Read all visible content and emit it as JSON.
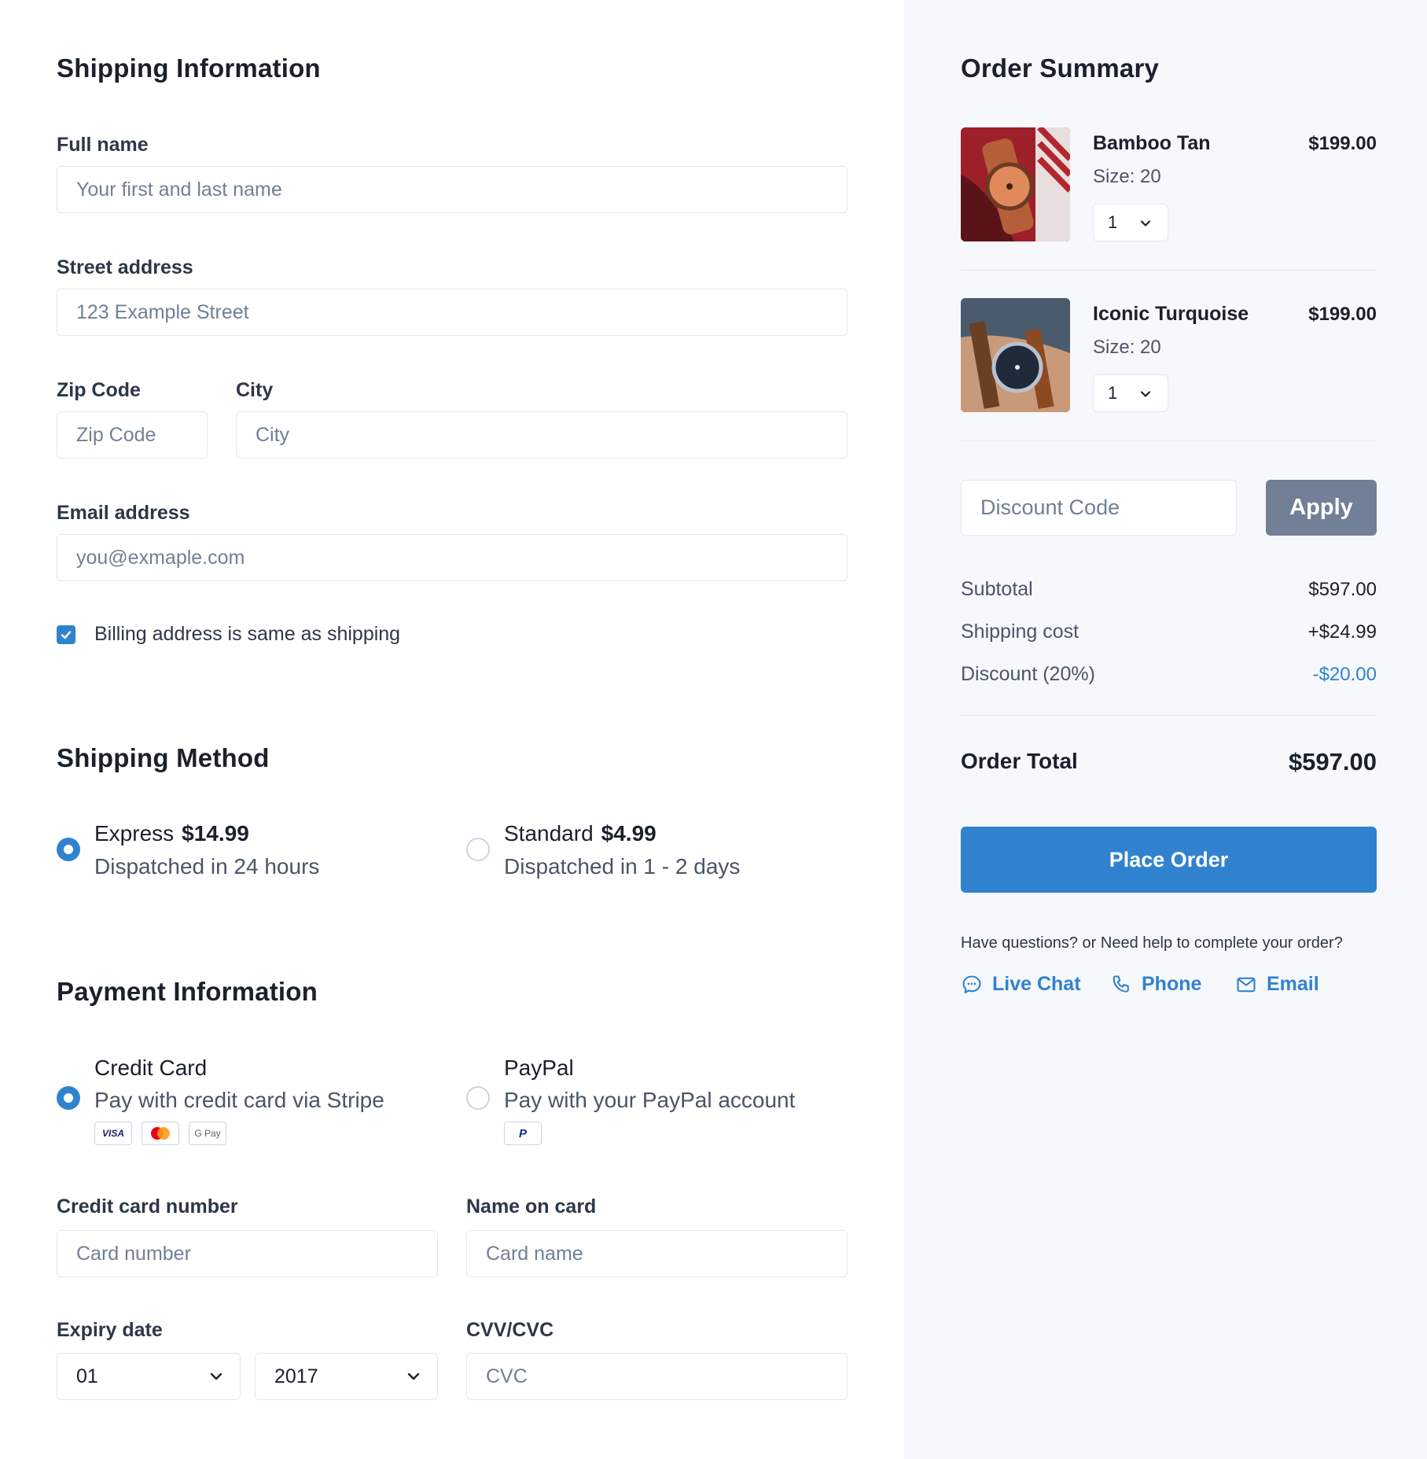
{
  "shipping": {
    "title": "Shipping Information",
    "full_name": {
      "label": "Full name",
      "placeholder": "Your first and last name"
    },
    "street": {
      "label": "Street address",
      "placeholder": "123 Example Street"
    },
    "zip": {
      "label": "Zip Code",
      "placeholder": "Zip Code"
    },
    "city": {
      "label": "City",
      "placeholder": "City"
    },
    "email": {
      "label": "Email address",
      "placeholder": "you@exmaple.com"
    },
    "billing_same": {
      "label": "Billing address is same as shipping",
      "checked": true
    }
  },
  "shipping_method": {
    "title": "Shipping Method",
    "options": [
      {
        "name": "Express",
        "price": "$14.99",
        "desc": "Dispatched in 24 hours",
        "selected": true
      },
      {
        "name": "Standard",
        "price": "$4.99",
        "desc": "Dispatched in 1 - 2 days",
        "selected": false
      }
    ]
  },
  "payment": {
    "title": "Payment Information",
    "options": [
      {
        "name": "Credit Card",
        "desc": "Pay with credit card via Stripe",
        "selected": true,
        "badges": [
          "VISA",
          "mastercard",
          "G Pay"
        ]
      },
      {
        "name": "PayPal",
        "desc": "Pay with your PayPal account",
        "selected": false,
        "badges": [
          "P"
        ]
      }
    ],
    "card_number": {
      "label": "Credit card number",
      "placeholder": "Card number"
    },
    "card_name": {
      "label": "Name on card",
      "placeholder": "Card name"
    },
    "expiry": {
      "label": "Expiry date",
      "month": "01",
      "year": "2017"
    },
    "cvc": {
      "label": "CVV/CVC",
      "placeholder": "CVC"
    }
  },
  "summary": {
    "title": "Order Summary",
    "items": [
      {
        "name": "Bamboo Tan",
        "size": "Size: 20",
        "price": "$199.00",
        "qty": "1"
      },
      {
        "name": "Iconic Turquoise",
        "size": "Size: 20",
        "price": "$199.00",
        "qty": "1"
      }
    ],
    "discount_placeholder": "Discount Code",
    "apply_label": "Apply",
    "rows": [
      {
        "label": "Subtotal",
        "value": "$597.00"
      },
      {
        "label": "Shipping cost",
        "value": "+$24.99"
      },
      {
        "label": "Discount (20%)",
        "value": "-$20.00"
      }
    ],
    "total_label": "Order Total",
    "total_value": "$597.00",
    "place_order": "Place Order",
    "help_text": "Have questions? or Need help to complete your order?",
    "help_links": [
      "Live Chat",
      "Phone",
      "Email"
    ]
  },
  "colors": {
    "accent": "#3182ce",
    "apply_button": "#718096",
    "summary_bg": "#f6f8fb",
    "discount_value": "#3182ce"
  }
}
